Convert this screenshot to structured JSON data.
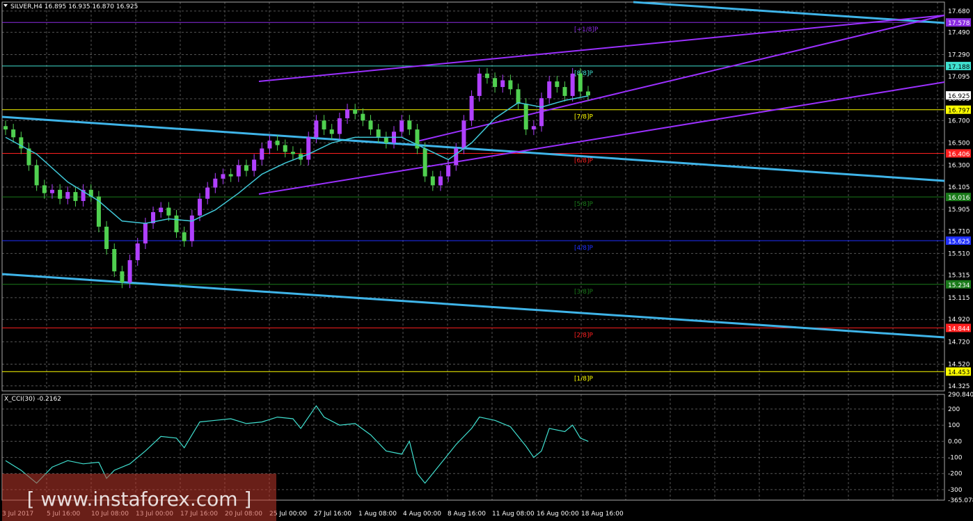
{
  "header": {
    "symbol": "SILVER,H4",
    "open": "16.895",
    "high": "16.935",
    "low": "16.870",
    "close": "16.925"
  },
  "indicator": {
    "label": "X_CCI(30) -0.2162",
    "axis_labels": [
      "290.8402",
      "200",
      "100",
      "0.00",
      "-100",
      "-200",
      "-300",
      "-365.0787"
    ],
    "levels": [
      290.8402,
      200,
      100,
      0,
      -100,
      -200,
      -300,
      -365.0787
    ]
  },
  "price_axis": {
    "labels": [
      "17.680",
      "17.490",
      "17.290",
      "17.095",
      "16.895",
      "16.700",
      "16.500",
      "16.300",
      "16.105",
      "15.905",
      "15.710",
      "15.510",
      "15.315",
      "15.115",
      "14.920",
      "14.720",
      "14.520",
      "14.325"
    ]
  },
  "time_axis": {
    "labels": [
      "3 Jul 2017",
      "5 Jul 16:00",
      "10 Jul 08:00",
      "13 Jul 00:00",
      "17 Jul 16:00",
      "20 Jul 08:00",
      "25 Jul 00:00",
      "27 Jul 16:00",
      "1 Aug 08:00",
      "4 Aug 00:00",
      "8 Aug 16:00",
      "11 Aug 08:00",
      "16 Aug 00:00",
      "18 Aug 16:00"
    ]
  },
  "murrey_levels": [
    {
      "label": "[+1/8]P",
      "price": 17.578,
      "tag": "17.578",
      "color": "#8b2be2"
    },
    {
      "label": "[8/8]P",
      "price": 17.188,
      "tag": "17.188",
      "color": "#40e0d0"
    },
    {
      "label": "[7/8]P",
      "price": 16.797,
      "tag": "16.797",
      "color": "#ffff00"
    },
    {
      "label": "[6/8]P",
      "price": 16.406,
      "tag": "16.406",
      "color": "#ff2020"
    },
    {
      "label": "[5/8]P",
      "price": 16.016,
      "tag": "16.016",
      "color": "#1a7a1a"
    },
    {
      "label": "[4/8]P",
      "price": 15.625,
      "tag": "15.625",
      "color": "#2030ff"
    },
    {
      "label": "[3/8]P",
      "price": 15.234,
      "tag": "15.234",
      "color": "#1a7a1a"
    },
    {
      "label": "[2/8]P",
      "price": 14.844,
      "tag": "14.844",
      "color": "#ff2020"
    },
    {
      "label": "[1/8]P",
      "price": 14.453,
      "tag": "14.453",
      "color": "#ffff00"
    }
  ],
  "last_price_tag": "16.925",
  "watermark": {
    "text": "[ www.instaforex.com ]"
  },
  "chart_data": {
    "type": "candlestick",
    "symbol": "SILVER,H4",
    "ylim": [
      14.28,
      17.76
    ],
    "cci_ylim": [
      -365.0787,
      290.8402
    ],
    "close_path": [
      [
        0,
        16.62
      ],
      [
        1,
        16.55
      ],
      [
        2,
        16.45
      ],
      [
        3,
        16.3
      ],
      [
        4,
        16.12
      ],
      [
        5,
        16.05
      ],
      [
        6,
        16.08
      ],
      [
        7,
        16.0
      ],
      [
        8,
        16.06
      ],
      [
        9,
        15.98
      ],
      [
        10,
        16.08
      ],
      [
        11,
        16.02
      ],
      [
        12,
        15.75
      ],
      [
        13,
        15.55
      ],
      [
        14,
        15.35
      ],
      [
        15,
        15.25
      ],
      [
        16,
        15.45
      ],
      [
        17,
        15.6
      ],
      [
        18,
        15.78
      ],
      [
        19,
        15.88
      ],
      [
        20,
        15.92
      ],
      [
        21,
        15.85
      ],
      [
        22,
        15.7
      ],
      [
        23,
        15.62
      ],
      [
        24,
        15.85
      ],
      [
        25,
        16.0
      ],
      [
        26,
        16.1
      ],
      [
        27,
        16.18
      ],
      [
        28,
        16.22
      ],
      [
        29,
        16.2
      ],
      [
        30,
        16.3
      ],
      [
        31,
        16.25
      ],
      [
        32,
        16.35
      ],
      [
        33,
        16.45
      ],
      [
        34,
        16.52
      ],
      [
        35,
        16.48
      ],
      [
        36,
        16.42
      ],
      [
        37,
        16.4
      ],
      [
        38,
        16.35
      ],
      [
        39,
        16.55
      ],
      [
        40,
        16.7
      ],
      [
        41,
        16.62
      ],
      [
        42,
        16.58
      ],
      [
        43,
        16.72
      ],
      [
        44,
        16.8
      ],
      [
        45,
        16.76
      ],
      [
        46,
        16.7
      ],
      [
        47,
        16.62
      ],
      [
        48,
        16.55
      ],
      [
        49,
        16.5
      ],
      [
        50,
        16.6
      ],
      [
        51,
        16.7
      ],
      [
        52,
        16.62
      ],
      [
        53,
        16.45
      ],
      [
        54,
        16.2
      ],
      [
        55,
        16.12
      ],
      [
        56,
        16.2
      ],
      [
        57,
        16.3
      ],
      [
        58,
        16.45
      ],
      [
        59,
        16.7
      ],
      [
        60,
        16.92
      ],
      [
        61,
        17.12
      ],
      [
        62,
        17.08
      ],
      [
        63,
        17.0
      ],
      [
        64,
        17.06
      ],
      [
        65,
        16.98
      ],
      [
        66,
        16.85
      ],
      [
        67,
        16.62
      ],
      [
        68,
        16.65
      ],
      [
        69,
        16.9
      ],
      [
        70,
        17.05
      ],
      [
        71,
        17.0
      ],
      [
        72,
        16.92
      ],
      [
        73,
        17.12
      ],
      [
        74,
        16.96
      ],
      [
        75,
        16.925
      ]
    ],
    "cci_path": [
      [
        0,
        -120
      ],
      [
        2,
        -180
      ],
      [
        4,
        -260
      ],
      [
        6,
        -160
      ],
      [
        8,
        -120
      ],
      [
        10,
        -140
      ],
      [
        12,
        -130
      ],
      [
        13,
        -230
      ],
      [
        14,
        -180
      ],
      [
        16,
        -140
      ],
      [
        18,
        -60
      ],
      [
        20,
        30
      ],
      [
        22,
        20
      ],
      [
        23,
        -40
      ],
      [
        25,
        120
      ],
      [
        27,
        130
      ],
      [
        29,
        140
      ],
      [
        31,
        110
      ],
      [
        33,
        120
      ],
      [
        35,
        150
      ],
      [
        37,
        140
      ],
      [
        38,
        80
      ],
      [
        40,
        220
      ],
      [
        41,
        150
      ],
      [
        43,
        100
      ],
      [
        45,
        110
      ],
      [
        47,
        40
      ],
      [
        49,
        -60
      ],
      [
        51,
        -80
      ],
      [
        52,
        0
      ],
      [
        53,
        -200
      ],
      [
        54,
        -260
      ],
      [
        56,
        -140
      ],
      [
        58,
        -20
      ],
      [
        60,
        80
      ],
      [
        61,
        150
      ],
      [
        63,
        130
      ],
      [
        65,
        90
      ],
      [
        67,
        -30
      ],
      [
        68,
        -100
      ],
      [
        69,
        -60
      ],
      [
        70,
        80
      ],
      [
        72,
        60
      ],
      [
        73,
        100
      ],
      [
        74,
        20
      ],
      [
        75,
        0
      ]
    ],
    "ma_path": [
      [
        0,
        16.55
      ],
      [
        4,
        16.4
      ],
      [
        8,
        16.15
      ],
      [
        12,
        15.98
      ],
      [
        15,
        15.8
      ],
      [
        18,
        15.78
      ],
      [
        21,
        15.82
      ],
      [
        24,
        15.8
      ],
      [
        27,
        15.9
      ],
      [
        30,
        16.05
      ],
      [
        33,
        16.22
      ],
      [
        36,
        16.32
      ],
      [
        39,
        16.4
      ],
      [
        42,
        16.5
      ],
      [
        45,
        16.55
      ],
      [
        48,
        16.55
      ],
      [
        51,
        16.55
      ],
      [
        54,
        16.45
      ],
      [
        57,
        16.35
      ],
      [
        60,
        16.5
      ],
      [
        63,
        16.72
      ],
      [
        66,
        16.86
      ],
      [
        69,
        16.82
      ],
      [
        72,
        16.88
      ],
      [
        75,
        16.92
      ]
    ]
  }
}
